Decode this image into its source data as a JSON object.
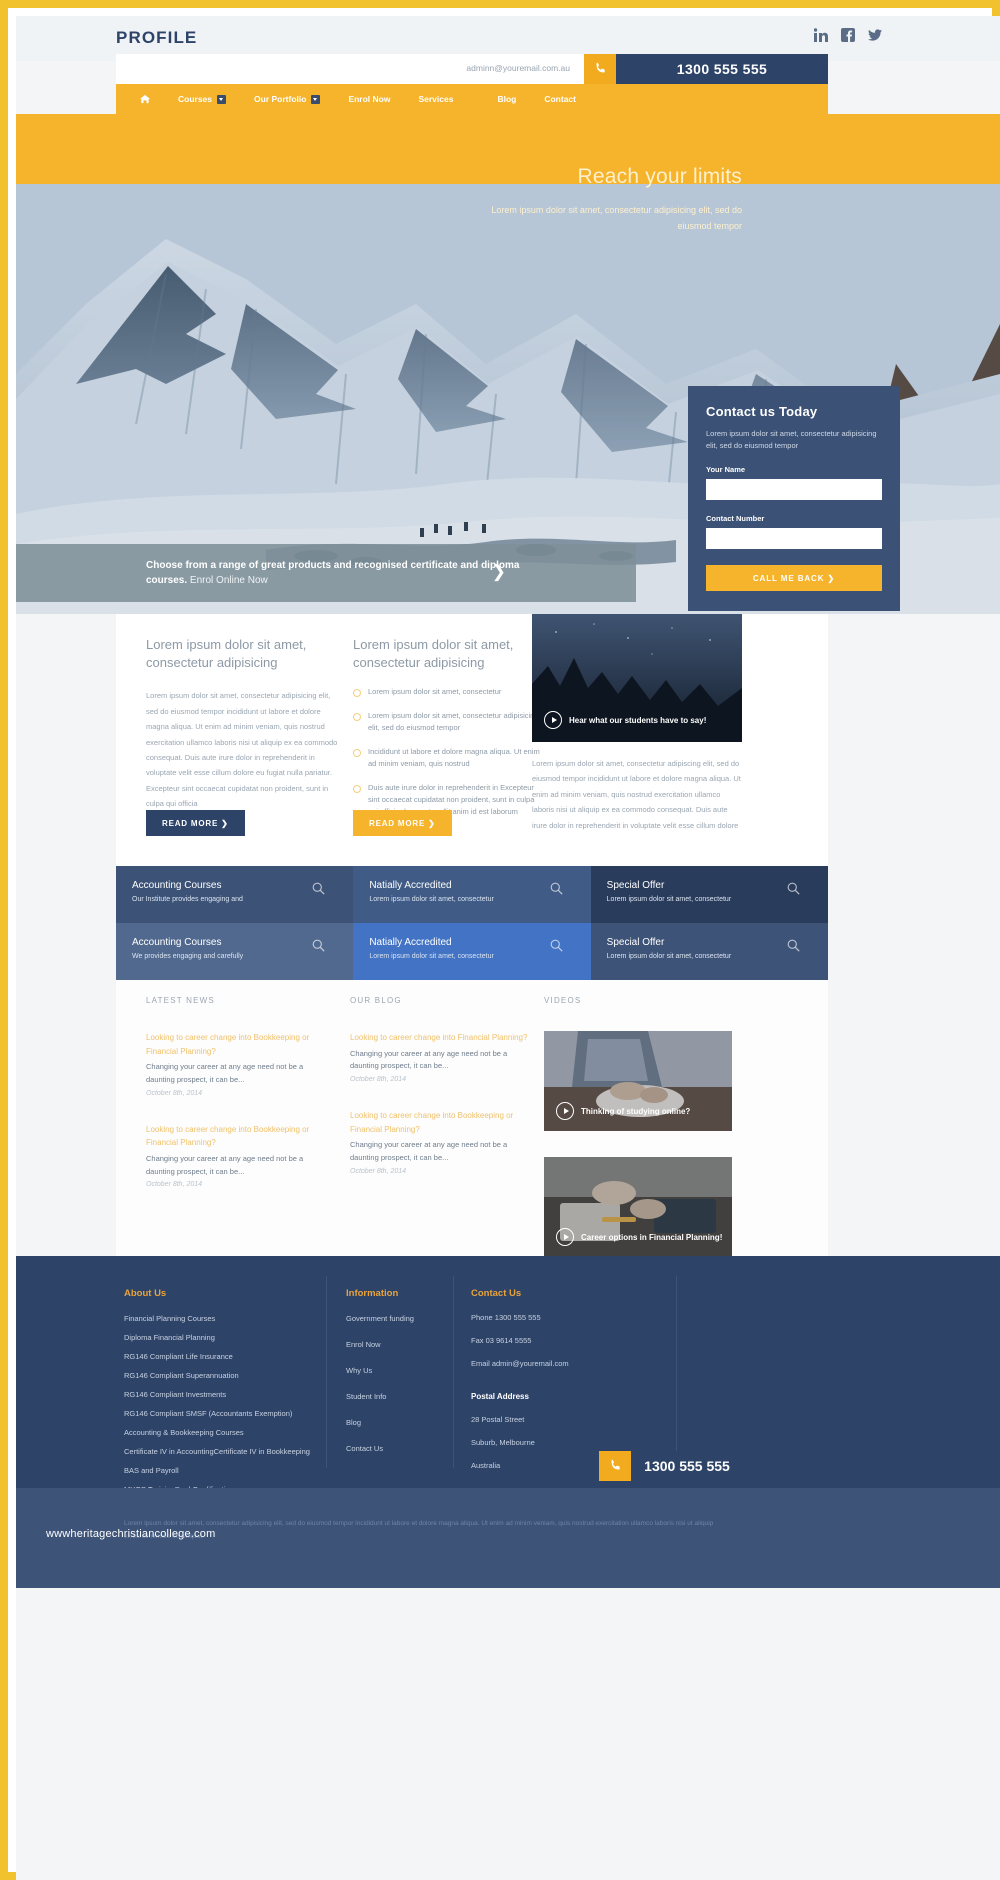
{
  "brand": "PROFILE",
  "social": [
    {
      "name": "linkedin-icon",
      "label": "in"
    },
    {
      "name": "facebook-icon",
      "label": "f"
    },
    {
      "name": "twitter-icon",
      "label": "t"
    }
  ],
  "strip": {
    "email": "adminn@youremail.com.au",
    "phone": "1300 555 555",
    "phone_icon": "phone-icon"
  },
  "nav": {
    "home_icon": "home-icon",
    "items": [
      {
        "label": "Courses",
        "caret": true
      },
      {
        "label": "Our Portfolio",
        "caret": true
      },
      {
        "label": "Enrol Now",
        "caret": false
      },
      {
        "label": "Services",
        "caret": false
      },
      {
        "label": "Blog",
        "caret": false
      },
      {
        "label": "Contact",
        "caret": false
      }
    ]
  },
  "hero": {
    "title": "Reach your limits",
    "subtitle": "Lorem ipsum dolor sit amet, consectetur adipisicing elit, sed do eiusmod tempor"
  },
  "contact_card": {
    "title": "Contact us Today",
    "blurb": "Lorem ipsum dolor sit amet, consectetur adipisicing elit, sed do eiusmod tempor",
    "name_label": "Your Name",
    "name_value": "",
    "name_placeholder": "",
    "number_label": "Contact Number",
    "number_value": "",
    "number_placeholder": "",
    "button": "CALL ME BACK  ❯"
  },
  "cta_strip": {
    "text": "Choose from a range of great products and recognised certificate and diploma courses.",
    "link": "Enrol Online Now",
    "arrow": "❯"
  },
  "main": {
    "col1": {
      "heading": "Lorem ipsum dolor sit amet, consectetur adipisicing",
      "body": "Lorem ipsum dolor sit amet, consectetur adipisicing elit, sed do eiusmod tempor incididunt ut labore et dolore magna aliqua. Ut enim ad minim veniam, quis nostrud exercitation ullamco laboris nisi ut aliquip ex ea commodo consequat. Duis aute irure dolor in reprehenderit in voluptate velit esse cillum dolore eu fugiat nulla pariatur. Excepteur sint occaecat cupidatat non proident, sunt in culpa qui officia",
      "button": "READ MORE  ❯"
    },
    "col2": {
      "heading": "Lorem ipsum dolor sit amet, consectetur adipisicing",
      "bullets": [
        "Lorem ipsum dolor sit amet, consectetur",
        "Lorem ipsum dolor sit amet, consectetur adipisicing elit, sed do eiusmod tempor",
        "Incididunt ut labore et dolore magna aliqua. Ut enim ad minim veniam, quis nostrud",
        "Duis aute irure dolor in reprehenderit in Excepteur sint occaecat cupidatat non proident, sunt in culpa qui officia deserunt mollit anim id est laborum"
      ],
      "button": "READ MORE  ❯"
    },
    "col3": {
      "video_caption": "Hear what our students have to say!",
      "body": "Lorem ipsum dolor sit amet, consectetur adipiscing elit, sed do eiusmod tempor incididunt ut labore et dolore magna aliqua. Ut enim ad minim veniam, quis nostrud exercitation ullamco laboris nisi ut aliquip ex ea commodo consequat. Duis aute irure dolor in reprehenderit in voluptate velit esse cillum dolore"
    }
  },
  "features": [
    {
      "title": "Accounting Courses",
      "sub": "Our Institute provides engaging and",
      "bg": "#3c5277",
      "icon": "magnifier-icon"
    },
    {
      "title": "Natially Accredited",
      "sub": "Lorem ipsum dolor sit amet, consectetur",
      "bg": "#3f5b86",
      "icon": "magnifier-icon"
    },
    {
      "title": "Special Offer",
      "sub": "Lorem ipsum dolor sit amet, consectetur",
      "bg": "#2a3c5c",
      "icon": "magnifier-icon"
    },
    {
      "title": "Accounting Courses",
      "sub": "We provides engaging and carefully",
      "bg": "#51698e",
      "icon": "magnifier-icon"
    },
    {
      "title": "Natially Accredited",
      "sub": "Lorem ipsum dolor sit amet, consectetur",
      "bg": "#4273c4",
      "icon": "magnifier-icon"
    },
    {
      "title": "Special Offer",
      "sub": "Lorem ipsum dolor sit amet, consectetur",
      "bg": "#3e5378",
      "icon": "magnifier-icon"
    }
  ],
  "news": {
    "latest_heading": "LATEST NEWS",
    "blog_heading": "OUR BLOG",
    "videos_heading": "VIDEOS",
    "latest": [
      {
        "title": "Looking to career change into Bookkeeping or Financial Planning?",
        "excerpt": "Changing your career at any age need not be a daunting prospect, it can be...",
        "date": "October 8th, 2014"
      },
      {
        "title": "Looking to career change into Bookkeeping or Financial Planning?",
        "excerpt": "Changing your career at any age need not be a daunting prospect, it can be...",
        "date": "October 8th, 2014"
      }
    ],
    "blog": [
      {
        "title": "Looking to career change into Financial Planning?",
        "excerpt": "Changing your career at any age need not be a daunting prospect, it can be...",
        "date": "October 8th, 2014"
      },
      {
        "title": "Looking to career change into Bookkeeping or Financial Planning?",
        "excerpt": "Changing your career at any age need not be a daunting prospect, it can be...",
        "date": "October 8th, 2014"
      }
    ],
    "videos": [
      {
        "caption": "Thinking of studying online?",
        "play_icon": "play-icon"
      },
      {
        "caption": "Career options in Financial Planning!",
        "play_icon": "play-icon"
      }
    ]
  },
  "footer": {
    "about": {
      "heading": "About Us",
      "links": [
        "Financial Planning Courses",
        "Diploma Financial Planning",
        "RG146 Compliant Life Insurance",
        "RG146 Compliant Superannuation",
        "RG146 Compliant Investments",
        "RG146 Compliant SMSF (Accountants Exemption)",
        "Accounting & Bookkeeping Courses",
        "Certificate IV in AccountingCertificate IV in Bookkeeping",
        "BAS and Payroll",
        "MYOB TrainingDual Qualifications"
      ]
    },
    "information": {
      "heading": "Information",
      "links": [
        "Government funding",
        "Enrol Now",
        "Why Us",
        "Student Info",
        "Blog",
        "Contact Us"
      ]
    },
    "contact": {
      "heading": "Contact Us",
      "phone": "Phone 1300 555 555",
      "fax": "Fax 03 9614 5555",
      "email": "Email admin@youremail.com",
      "postal_heading": "Postal Address",
      "address": [
        "28 Postal Street",
        "Suburb, Melbourne",
        "Australia"
      ]
    },
    "phone_button": {
      "icon": "phone-icon",
      "number": "1300 555 555"
    },
    "legal": "Lorem ipsum dolor sit amet, consectetur adipisicing elit, sed do eiusmod tempor incididunt ut labore et dolore magna aliqua. Ut enim ad minim veniam, quis nostrud exercitation ullamco laboris nisi ut aliquip ex ea commodo consequat."
  },
  "watermark": "wwwheritagechristiancollege.com",
  "colors": {
    "gold": "#f6b32c",
    "navy": "#2d4368",
    "panel": "#3b5175"
  }
}
